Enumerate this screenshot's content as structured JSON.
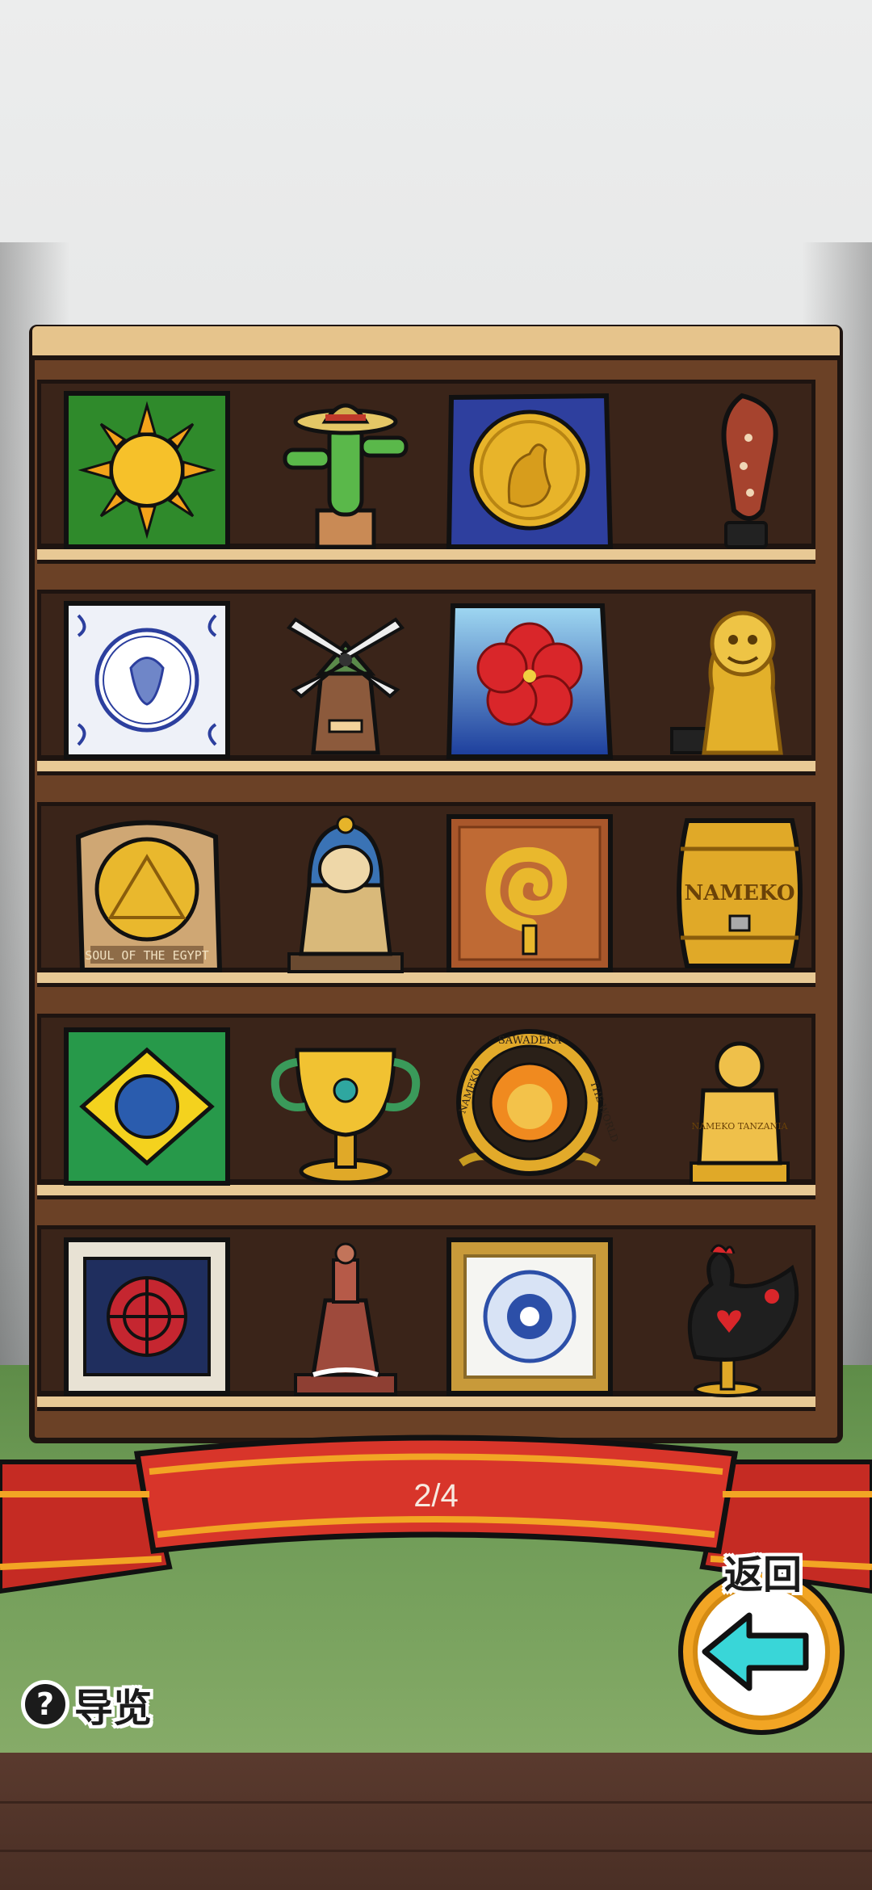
{
  "header": {
    "blank": ""
  },
  "shelf": {
    "rows": [
      {
        "items": [
          "sun-flag-icon",
          "cactus-sombrero-icon",
          "kangaroo-coin-icon",
          "boomerang-icon"
        ]
      },
      {
        "items": [
          "delft-tile-icon",
          "windmill-icon",
          "hibiscus-tile-icon",
          "shisa-lion-icon"
        ]
      },
      {
        "items": [
          "pyramid-plaque-icon",
          "pharaoh-bust-icon",
          "spiral-crate-icon",
          "nameko-barrel-icon"
        ]
      },
      {
        "items": [
          "brazil-flag-icon",
          "gold-cup-icon",
          "lion-medal-icon",
          "tanzania-trophy-icon"
        ]
      },
      {
        "items": [
          "red-wheel-frame-icon",
          "lighthouse-statue-icon",
          "blue-tile-frame-icon",
          "rooster-icon"
        ]
      }
    ],
    "labels": {
      "barrel": "NAMEKO",
      "medal_left": "NAMEKO",
      "medal_top": "SAWADEKA",
      "medal_right": "THE WORLD",
      "trophy": "NAMEKO TANZANIA",
      "plaque": "SOUL OF THE EGYPT"
    }
  },
  "pager": {
    "label": "2/4"
  },
  "guide": {
    "label": "导览",
    "icon": "question-icon"
  },
  "back": {
    "label": "返回",
    "icon": "back-arrow-icon"
  },
  "colors": {
    "ribbon": "#d8352a",
    "ribbon_stripe": "#f2a524",
    "shelf_wood": "#6b4126",
    "accent_cyan": "#39d6d8"
  }
}
